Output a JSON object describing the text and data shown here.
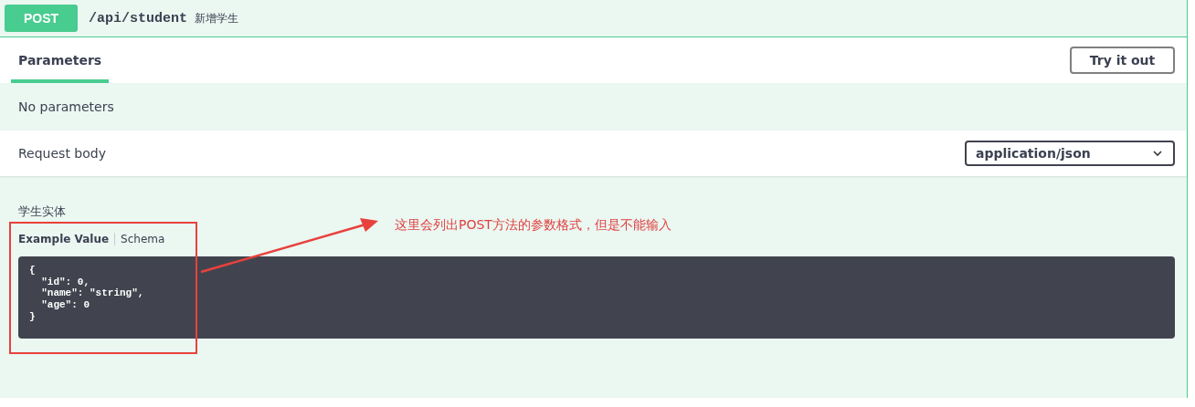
{
  "operation": {
    "method": "POST",
    "path": "/api/student",
    "summary": "新增学生"
  },
  "tabs": [
    {
      "label": "Parameters",
      "selected": true
    }
  ],
  "try_button": "Try it out",
  "parameters_message": "No parameters",
  "request_body": {
    "label": "Request body",
    "content_type": "application/json",
    "description": "学生实体",
    "example_tabs": [
      {
        "label": "Example Value",
        "selected": true
      },
      {
        "label": "Schema",
        "selected": false
      }
    ],
    "example_code": [
      "{",
      "  \"id\": 0,",
      "  \"name\": \"string\",",
      "  \"age\": 0",
      "}"
    ]
  },
  "annotation": {
    "text": "这里会列出POST方法的参数格式，但是不能输入"
  }
}
